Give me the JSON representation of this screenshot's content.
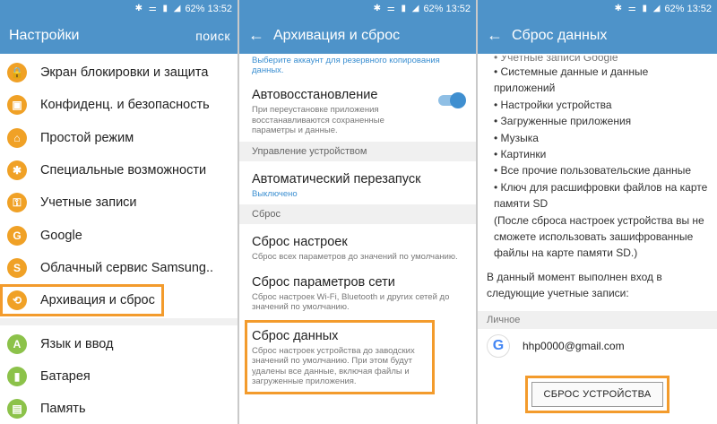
{
  "status": {
    "battery": "62%",
    "time": "13:52"
  },
  "panel1": {
    "title": "Настройки",
    "search": "поиск",
    "items": [
      {
        "label": "Экран блокировки и защита",
        "icon": "lock-icon",
        "glyph": "🔒",
        "color": "#f0a126"
      },
      {
        "label": "Конфиденц. и безопасность",
        "icon": "shield-icon",
        "glyph": "▣",
        "color": "#f0a126"
      },
      {
        "label": "Простой режим",
        "icon": "home-icon",
        "glyph": "⌂",
        "color": "#f0a126"
      },
      {
        "label": "Специальные возможности",
        "icon": "accessibility-icon",
        "glyph": "✱",
        "color": "#f0a126"
      },
      {
        "label": "Учетные записи",
        "icon": "key-icon",
        "glyph": "⚿",
        "color": "#f0a126"
      },
      {
        "label": "Google",
        "icon": "google-icon",
        "glyph": "G",
        "color": "#f0a126"
      },
      {
        "label": "Облачный сервис Samsung..",
        "icon": "samsung-cloud-icon",
        "glyph": "S",
        "color": "#f0a126"
      },
      {
        "label": "Архивация и сброс",
        "icon": "backup-icon",
        "glyph": "⟲",
        "color": "#f0a126"
      },
      {
        "label": "Язык и ввод",
        "icon": "language-icon",
        "glyph": "A",
        "color": "#8cc24a"
      },
      {
        "label": "Батарея",
        "icon": "battery-icon",
        "glyph": "▮",
        "color": "#8cc24a"
      },
      {
        "label": "Память",
        "icon": "storage-icon",
        "glyph": "▤",
        "color": "#8cc24a"
      }
    ]
  },
  "panel2": {
    "title": "Архивация и сброс",
    "top_note": "Выберите аккаунт для резервного копирования данных.",
    "autorestore": {
      "title": "Автовосстановление",
      "sub": "При переустановке приложения восстанавливаются сохраненные параметры и данные."
    },
    "section_device": "Управление устройством",
    "autorestart": {
      "title": "Автоматический перезапуск",
      "sub": "Выключено"
    },
    "section_reset": "Сброс",
    "reset_settings": {
      "title": "Сброс настроек",
      "sub": "Сброс всех параметров до значений по умолчанию."
    },
    "reset_network": {
      "title": "Сброс параметров сети",
      "sub": "Сброс настроек Wi-Fi, Bluetooth и других сетей до значений по умолчанию."
    },
    "factory_reset": {
      "title": "Сброс данных",
      "sub": "Сброс настроек устройства до заводских значений по умолчанию. При этом будут удалены все данные, включая файлы и загруженные приложения."
    }
  },
  "panel3": {
    "title": "Сброс данных",
    "partial": "Учетные записи Google",
    "bullets": [
      "• Системные данные и данные приложений",
      "• Настройки устройства",
      "• Загруженные приложения",
      "• Музыка",
      "• Картинки",
      "• Все прочие пользовательские данные",
      "• Ключ для расшифровки файлов на карте памяти SD"
    ],
    "note": "(После сброса настроек устройства вы не сможете использовать зашифрованные файлы на карте памяти SD.)",
    "accounts_text": "В данный момент выполнен вход в следующие учетные записи:",
    "section_personal": "Личное",
    "account_email": "hhp0000@gmail.com",
    "reset_button": "СБРОС УСТРОЙСТВА"
  }
}
